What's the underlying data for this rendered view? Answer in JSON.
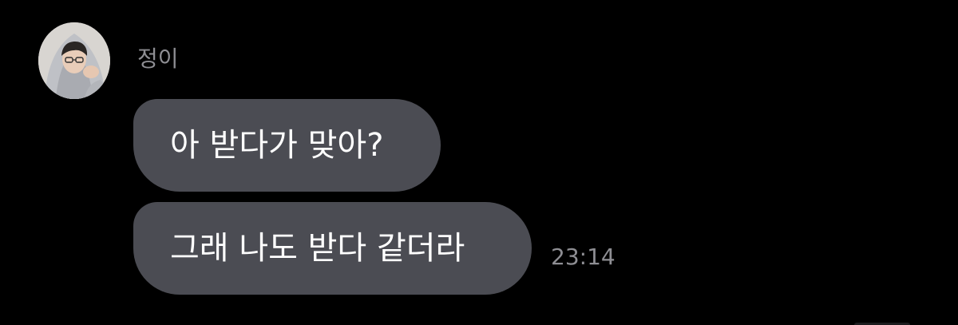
{
  "chat": {
    "sender": {
      "name": "정이",
      "avatar_icon": "profile-photo"
    },
    "messages": [
      {
        "text": "아 받다가 맞아?"
      },
      {
        "text": "그래 나도 받다 같더라"
      }
    ],
    "timestamp": "23:14"
  },
  "colors": {
    "background": "#000000",
    "bubble": "#4b4c53",
    "bubble_text": "#ffffff",
    "meta_text": "#8e8e93"
  }
}
